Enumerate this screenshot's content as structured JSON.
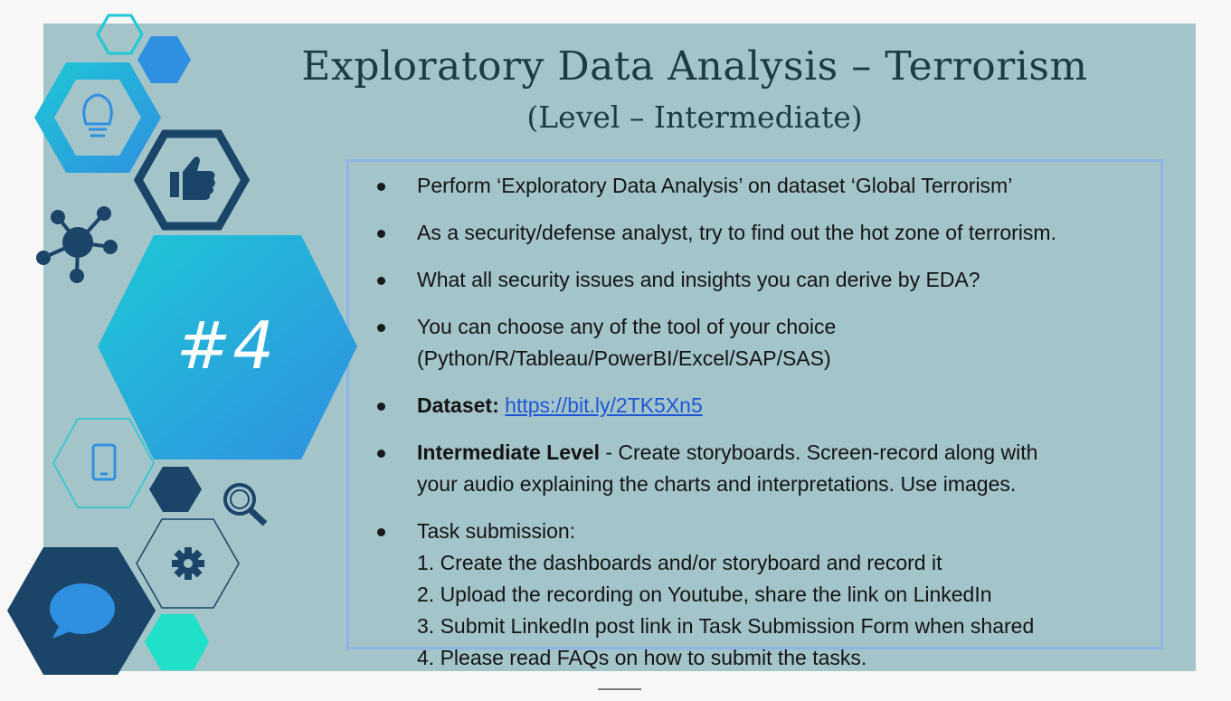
{
  "slide": {
    "title": "Exploratory Data Analysis – Terrorism",
    "subtitle": "(Level – Intermediate)",
    "badge": "#4",
    "icons": [
      "lightbulb-icon",
      "thumbs-up-icon",
      "network-icon",
      "phone-icon",
      "magnifier-icon",
      "gear-icon",
      "chat-bubble-icon"
    ],
    "colors": {
      "background": "#a3c4c9",
      "title": "#1f3a44",
      "hex_cyan": "#1ec8d6",
      "hex_navy": "#1a4468",
      "hex_blue": "#2f8fe0",
      "hex_mint": "#1fe0c8",
      "link": "#1f56d6",
      "box_border": "#8fb4e6"
    },
    "bullets": [
      {
        "lines": [
          "Perform ‘Exploratory Data Analysis’ on dataset  ‘Global Terrorism’"
        ]
      },
      {
        "lines": [
          "As a security/defense analyst, try to find out the hot zone of terrorism."
        ]
      },
      {
        "lines": [
          "What all security issues and insights you can derive by EDA?"
        ]
      },
      {
        "lines": [
          "You can choose any of the tool of your choice",
          "(Python/R/Tableau/PowerBI/Excel/SAP/SAS)"
        ]
      },
      {
        "bold": "Dataset:",
        "link": "https://bit.ly/2TK5Xn5"
      },
      {
        "bold": "Intermediate Level",
        "rest": " - Create storyboards. Screen-record along with",
        "line2": "your audio explaining the charts and interpretations. Use images."
      },
      {
        "lines": [
          "Task submission:",
          "1. Create the dashboards and/or storyboard and record it",
          "2. Upload the recording on Youtube, share the link on LinkedIn",
          "3. Submit LinkedIn post link in Task Submission Form when shared",
          "4. Please read FAQs on how to submit the tasks."
        ]
      }
    ]
  }
}
